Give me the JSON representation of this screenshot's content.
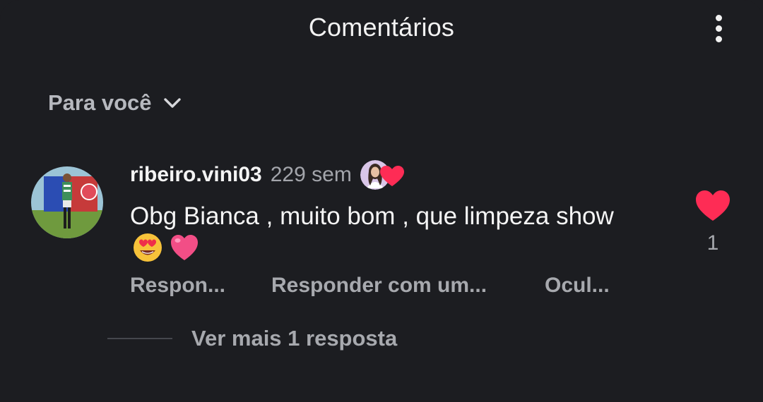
{
  "header": {
    "title": "Comentários",
    "menu_icon": "more-vertical-icon"
  },
  "sort": {
    "label": "Para você",
    "icon": "chevron-down-icon"
  },
  "comment": {
    "username": "ribeiro.vini03",
    "time": "229 sem",
    "text": "Obg Bianca , muito bom , que limpeza show",
    "emojis": [
      "heart-eyes-emoji",
      "pink-heart-emoji"
    ],
    "liked_by_creator": true,
    "like_count": "1",
    "liked": true,
    "actions": {
      "reply": "Respon...",
      "reply_with": "Responder com um...",
      "hide": "Ocul..."
    },
    "more_replies": "Ver mais 1 resposta"
  },
  "colors": {
    "background": "#1c1d21",
    "primary_text": "#f4f4f4",
    "secondary_text": "#a7a9ae",
    "like_red": "#fe2c55"
  }
}
